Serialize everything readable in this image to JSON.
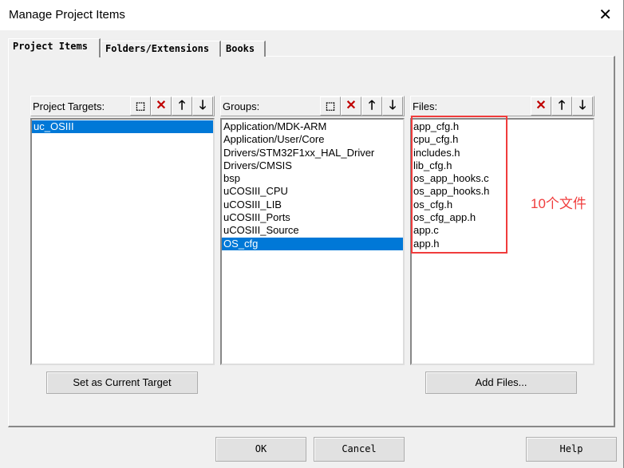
{
  "window": {
    "title": "Manage Project Items",
    "close_icon": "close-icon"
  },
  "tabs": [
    {
      "label": "Project Items"
    },
    {
      "label": "Folders/Extensions"
    },
    {
      "label": "Books"
    }
  ],
  "targets": {
    "label": "Project Targets:",
    "items": [
      "uc_OSIII"
    ],
    "selected": 0
  },
  "groups": {
    "label": "Groups:",
    "items": [
      "Application/MDK-ARM",
      "Application/User/Core",
      "Drivers/STM32F1xx_HAL_Driver",
      "Drivers/CMSIS",
      "bsp",
      "uCOSIII_CPU",
      "uCOSIII_LIB",
      "uCOSIII_Ports",
      "uCOSIII_Source",
      "OS_cfg"
    ],
    "selected": 9
  },
  "files": {
    "label": "Files:",
    "items": [
      "app_cfg.h",
      "cpu_cfg.h",
      "includes.h",
      "lib_cfg.h",
      "os_app_hooks.c",
      "os_app_hooks.h",
      "os_cfg.h",
      "os_cfg_app.h",
      "app.c",
      "app.h"
    ]
  },
  "buttons": {
    "set_target": "Set as Current Target",
    "add_files": "Add Files...",
    "ok": "OK",
    "cancel": "Cancel",
    "help": "Help"
  },
  "annotation": {
    "text": "10个文件",
    "color": "#f03c3c"
  },
  "colors": {
    "selection": "#0078d7"
  }
}
